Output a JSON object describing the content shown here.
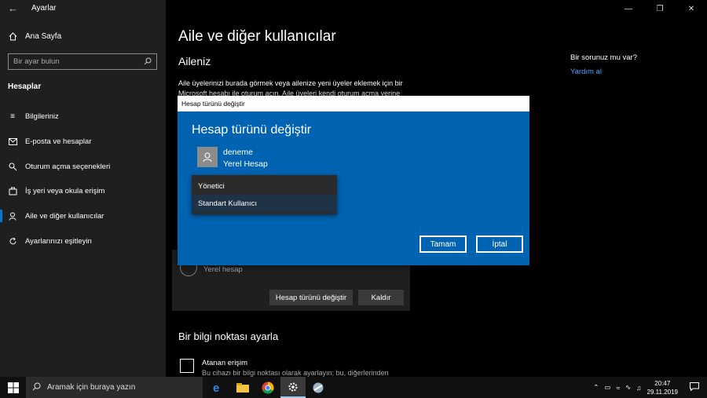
{
  "window": {
    "title": "Ayarlar"
  },
  "sidebar": {
    "home_label": "Ana Sayfa",
    "search_placeholder": "Bir ayar bulun",
    "section_label": "Hesaplar",
    "items": [
      {
        "label": "Bilgileriniz",
        "icon": "person-card-icon"
      },
      {
        "label": "E-posta ve hesaplar",
        "icon": "mail-icon"
      },
      {
        "label": "Oturum açma seçenekleri",
        "icon": "key-icon"
      },
      {
        "label": "İş yeri veya okula erişim",
        "icon": "briefcase-icon"
      },
      {
        "label": "Aile ve diğer kullanıcılar",
        "icon": "people-icon",
        "active": true
      },
      {
        "label": "Ayarlarınızı eşitleyin",
        "icon": "sync-icon"
      }
    ]
  },
  "main": {
    "title": "Aile ve diğer kullanıcılar",
    "subtitle": "Aileniz",
    "description": "Aile üyelerinizi burada görmek veya ailenize yeni üyeler eklemek için bir Microsoft hesabı ile oturum açın. Aile üyeleri kendi oturum açma yerine",
    "help_question": "Bir sorunuz mu var?",
    "help_link": "Yardım al",
    "account_card": {
      "type_label": "Yerel hesap",
      "change_button": "Hesap türünü değiştir",
      "remove_button": "Kaldır"
    },
    "hotspot_title": "Bir bilgi noktası ayarla",
    "assigned_access_title": "Atanan erişim",
    "assigned_access_desc": "Bu cihazı bir bilgi noktası olarak ayarlayın; bu, diğerlerinden"
  },
  "dialog": {
    "titlebar": "Hesap türünü değiştir",
    "heading": "Hesap türünü değiştir",
    "user_name": "deneme",
    "user_type": "Yerel Hesap",
    "options": [
      "Yönetici",
      "Standart Kullanıcı"
    ],
    "selected_option": "Standart Kullanıcı",
    "ok_button": "Tamam",
    "cancel_button": "İptal"
  },
  "taskbar": {
    "search_placeholder": "Aramak için buraya yazın",
    "apps": [
      "edge-icon",
      "file-explorer-icon",
      "chrome-icon",
      "settings-icon",
      "app-icon"
    ],
    "time": "20:47",
    "date": "29.11.2019"
  },
  "colors": {
    "accent": "#0078d7",
    "dialog_bg": "#0063b1",
    "link": "#4aa4ff"
  }
}
